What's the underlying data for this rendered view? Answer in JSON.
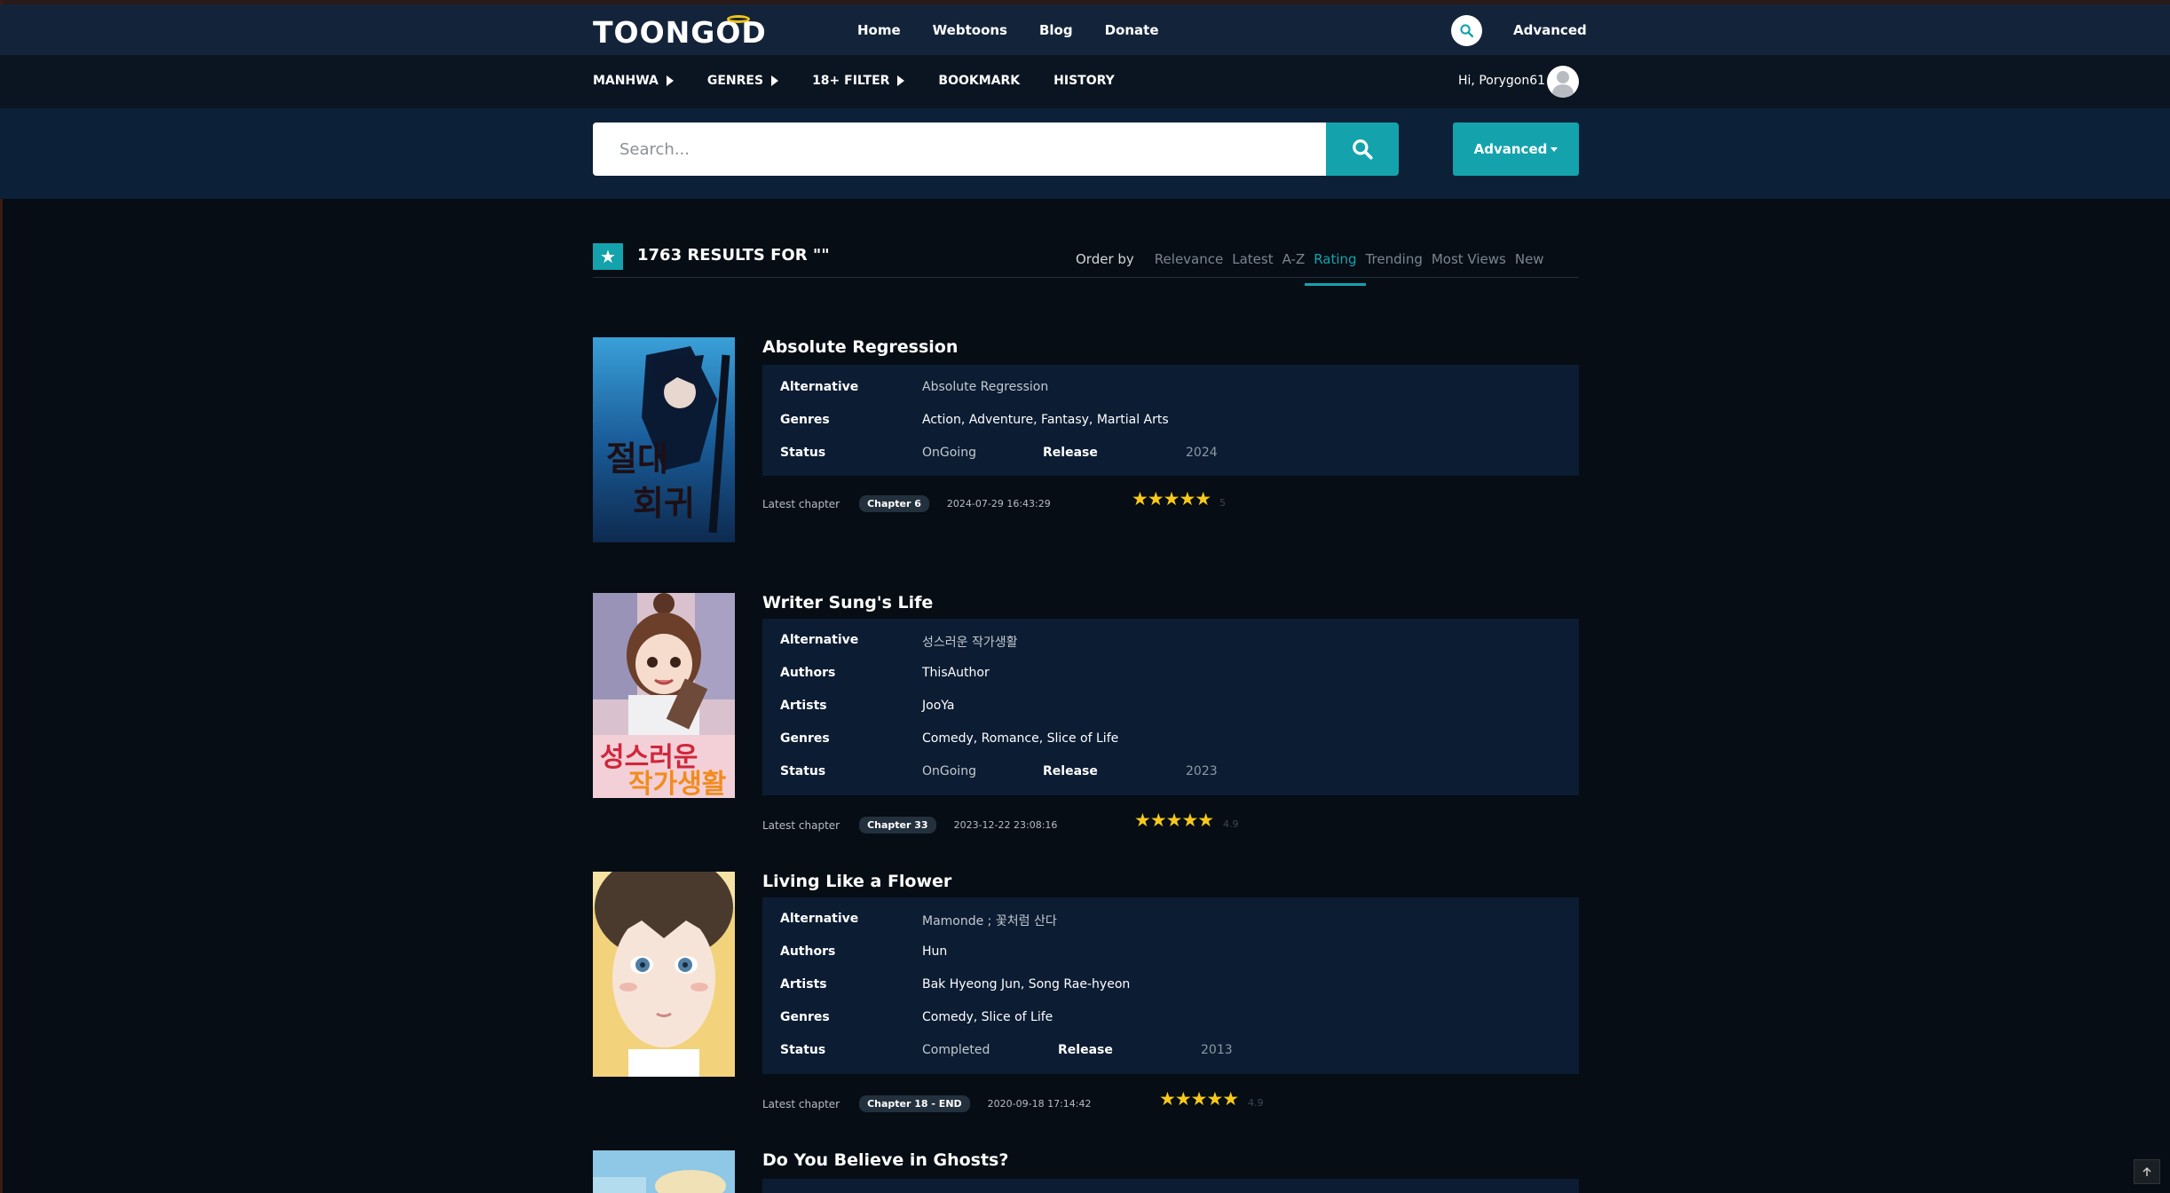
{
  "brand": {
    "name": "TOONGOD",
    "halo_color": "#f2c417",
    "accent": "#14a3ad"
  },
  "nav": {
    "links": [
      "Home",
      "Webtoons",
      "Blog",
      "Donate"
    ],
    "advanced": "Advanced"
  },
  "subnav": {
    "items": [
      "MANHWA",
      "GENRES",
      "18+ FILTER",
      "BOOKMARK",
      "HISTORY"
    ],
    "greeting": "Hi, Porygon61"
  },
  "search": {
    "placeholder": "Search...",
    "advanced_label": "Advanced"
  },
  "results": {
    "title": "1763 RESULTS FOR \"\"",
    "order_label": "Order by",
    "order_options": [
      "Relevance",
      "Latest",
      "A-Z",
      "Rating",
      "Trending",
      "Most Views",
      "New"
    ],
    "active_order": "Rating"
  },
  "entries": [
    {
      "title": "Absolute Regression",
      "fields": [
        {
          "key": "Alternative",
          "value": "Absolute Regression"
        },
        {
          "key": "Genres",
          "value": "Action, Adventure, Fantasy, Martial Arts"
        },
        {
          "key": "Status",
          "value": "OnGoing"
        }
      ],
      "release_label": "Release",
      "release": "2024",
      "latest_label": "Latest chapter",
      "chapter": "Chapter 6",
      "date": "2024-07-29 16:43:29",
      "stars": "★★★★★",
      "score": "5"
    },
    {
      "title": "Writer Sung's Life",
      "fields": [
        {
          "key": "Alternative",
          "value": "성스러운 작가생활"
        },
        {
          "key": "Authors",
          "value": "ThisAuthor"
        },
        {
          "key": "Artists",
          "value": "JooYa"
        },
        {
          "key": "Genres",
          "value": "Comedy, Romance, Slice of Life"
        },
        {
          "key": "Status",
          "value": "OnGoing"
        }
      ],
      "release_label": "Release",
      "release": "2023",
      "latest_label": "Latest chapter",
      "chapter": "Chapter 33",
      "date": "2023-12-22 23:08:16",
      "stars": "★★★★★",
      "score": "4.9"
    },
    {
      "title": "Living Like a Flower",
      "fields": [
        {
          "key": "Alternative",
          "value": "Mamonde ; 꽃처럼 산다"
        },
        {
          "key": "Authors",
          "value": "Hun"
        },
        {
          "key": "Artists",
          "value": "Bak Hyeong Jun, Song Rae-hyeon"
        },
        {
          "key": "Genres",
          "value": "Comedy, Slice of Life"
        },
        {
          "key": "Status",
          "value": "Completed"
        }
      ],
      "release_label": "Release",
      "release": "2013",
      "latest_label": "Latest chapter",
      "chapter": "Chapter 18 - END",
      "date": "2020-09-18 17:14:42",
      "stars": "★★★★★",
      "score": "4.9"
    },
    {
      "title": "Do You Believe in Ghosts?"
    }
  ]
}
